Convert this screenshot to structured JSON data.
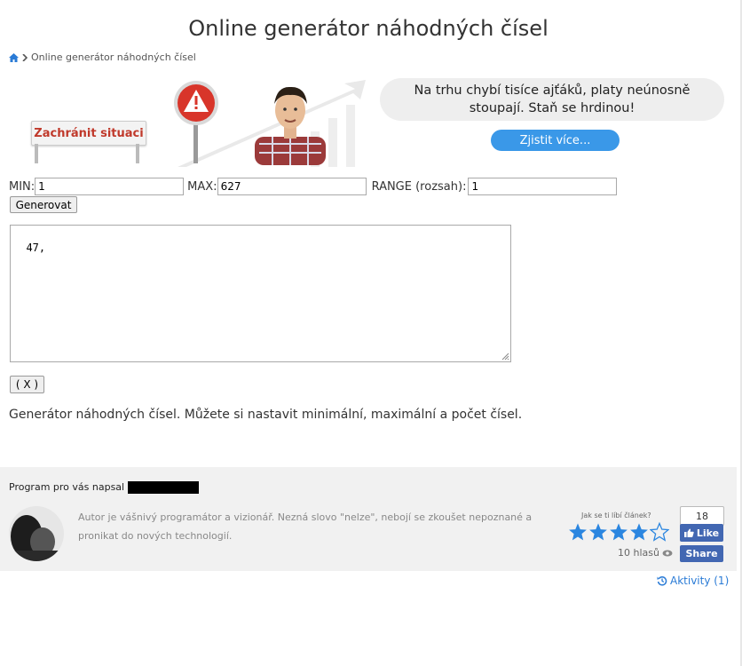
{
  "page": {
    "title": "Online generátor náhodných čísel"
  },
  "breadcrumb": {
    "current": "Online generátor náhodných čísel"
  },
  "banner": {
    "sign_text": "Zachránit situaci",
    "bubble_text": "Na trhu chybí tisíce ajťáků, platy neúnosně stoupají. Staň se hrdinou!",
    "cta_label": "Zjistit více..."
  },
  "form": {
    "min_label": "MIN:",
    "min_value": "1",
    "max_label": "MAX:",
    "max_value": "627",
    "range_label": "RANGE (rozsah):",
    "range_value": "1",
    "generate_label": "Generovat",
    "output_value": "47,",
    "clear_label": "( X )"
  },
  "description": "Generátor náhodných čísel. Můžete si nastavit minimální, maximální a počet čísel.",
  "author": {
    "heading": "Program pro vás napsal",
    "bio": "Autor je vášnivý programátor a vizionář. Nezná slovo \"nelze\", nebojí se zkoušet nepoznané a pronikat do nových technologií."
  },
  "rating": {
    "question": "Jak se ti líbí článek?",
    "stars_filled": 4,
    "stars_total": 5,
    "votes": "10 hlasů"
  },
  "facebook": {
    "count": "18",
    "like_label": "Like",
    "share_label": "Share"
  },
  "activity": {
    "label": "Aktivity (1)"
  },
  "colors": {
    "accent": "#3a98e8",
    "facebook": "#4267b2",
    "star": "#2b86e0",
    "link": "#2a7bd6"
  }
}
